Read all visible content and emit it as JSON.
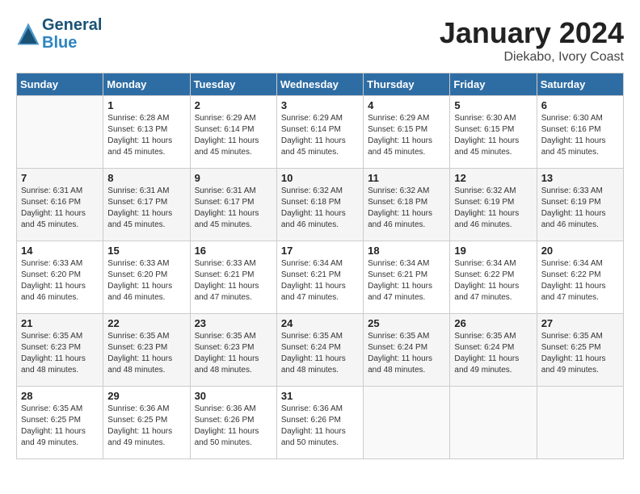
{
  "header": {
    "logo_line1": "General",
    "logo_line2": "Blue",
    "month": "January 2024",
    "location": "Diekabo, Ivory Coast"
  },
  "days_of_week": [
    "Sunday",
    "Monday",
    "Tuesday",
    "Wednesday",
    "Thursday",
    "Friday",
    "Saturday"
  ],
  "weeks": [
    [
      {
        "day": "",
        "sunrise": "",
        "sunset": "",
        "daylight": ""
      },
      {
        "day": "1",
        "sunrise": "Sunrise: 6:28 AM",
        "sunset": "Sunset: 6:13 PM",
        "daylight": "Daylight: 11 hours and 45 minutes."
      },
      {
        "day": "2",
        "sunrise": "Sunrise: 6:29 AM",
        "sunset": "Sunset: 6:14 PM",
        "daylight": "Daylight: 11 hours and 45 minutes."
      },
      {
        "day": "3",
        "sunrise": "Sunrise: 6:29 AM",
        "sunset": "Sunset: 6:14 PM",
        "daylight": "Daylight: 11 hours and 45 minutes."
      },
      {
        "day": "4",
        "sunrise": "Sunrise: 6:29 AM",
        "sunset": "Sunset: 6:15 PM",
        "daylight": "Daylight: 11 hours and 45 minutes."
      },
      {
        "day": "5",
        "sunrise": "Sunrise: 6:30 AM",
        "sunset": "Sunset: 6:15 PM",
        "daylight": "Daylight: 11 hours and 45 minutes."
      },
      {
        "day": "6",
        "sunrise": "Sunrise: 6:30 AM",
        "sunset": "Sunset: 6:16 PM",
        "daylight": "Daylight: 11 hours and 45 minutes."
      }
    ],
    [
      {
        "day": "7",
        "sunrise": "Sunrise: 6:31 AM",
        "sunset": "Sunset: 6:16 PM",
        "daylight": "Daylight: 11 hours and 45 minutes."
      },
      {
        "day": "8",
        "sunrise": "Sunrise: 6:31 AM",
        "sunset": "Sunset: 6:17 PM",
        "daylight": "Daylight: 11 hours and 45 minutes."
      },
      {
        "day": "9",
        "sunrise": "Sunrise: 6:31 AM",
        "sunset": "Sunset: 6:17 PM",
        "daylight": "Daylight: 11 hours and 45 minutes."
      },
      {
        "day": "10",
        "sunrise": "Sunrise: 6:32 AM",
        "sunset": "Sunset: 6:18 PM",
        "daylight": "Daylight: 11 hours and 46 minutes."
      },
      {
        "day": "11",
        "sunrise": "Sunrise: 6:32 AM",
        "sunset": "Sunset: 6:18 PM",
        "daylight": "Daylight: 11 hours and 46 minutes."
      },
      {
        "day": "12",
        "sunrise": "Sunrise: 6:32 AM",
        "sunset": "Sunset: 6:19 PM",
        "daylight": "Daylight: 11 hours and 46 minutes."
      },
      {
        "day": "13",
        "sunrise": "Sunrise: 6:33 AM",
        "sunset": "Sunset: 6:19 PM",
        "daylight": "Daylight: 11 hours and 46 minutes."
      }
    ],
    [
      {
        "day": "14",
        "sunrise": "Sunrise: 6:33 AM",
        "sunset": "Sunset: 6:20 PM",
        "daylight": "Daylight: 11 hours and 46 minutes."
      },
      {
        "day": "15",
        "sunrise": "Sunrise: 6:33 AM",
        "sunset": "Sunset: 6:20 PM",
        "daylight": "Daylight: 11 hours and 46 minutes."
      },
      {
        "day": "16",
        "sunrise": "Sunrise: 6:33 AM",
        "sunset": "Sunset: 6:21 PM",
        "daylight": "Daylight: 11 hours and 47 minutes."
      },
      {
        "day": "17",
        "sunrise": "Sunrise: 6:34 AM",
        "sunset": "Sunset: 6:21 PM",
        "daylight": "Daylight: 11 hours and 47 minutes."
      },
      {
        "day": "18",
        "sunrise": "Sunrise: 6:34 AM",
        "sunset": "Sunset: 6:21 PM",
        "daylight": "Daylight: 11 hours and 47 minutes."
      },
      {
        "day": "19",
        "sunrise": "Sunrise: 6:34 AM",
        "sunset": "Sunset: 6:22 PM",
        "daylight": "Daylight: 11 hours and 47 minutes."
      },
      {
        "day": "20",
        "sunrise": "Sunrise: 6:34 AM",
        "sunset": "Sunset: 6:22 PM",
        "daylight": "Daylight: 11 hours and 47 minutes."
      }
    ],
    [
      {
        "day": "21",
        "sunrise": "Sunrise: 6:35 AM",
        "sunset": "Sunset: 6:23 PM",
        "daylight": "Daylight: 11 hours and 48 minutes."
      },
      {
        "day": "22",
        "sunrise": "Sunrise: 6:35 AM",
        "sunset": "Sunset: 6:23 PM",
        "daylight": "Daylight: 11 hours and 48 minutes."
      },
      {
        "day": "23",
        "sunrise": "Sunrise: 6:35 AM",
        "sunset": "Sunset: 6:23 PM",
        "daylight": "Daylight: 11 hours and 48 minutes."
      },
      {
        "day": "24",
        "sunrise": "Sunrise: 6:35 AM",
        "sunset": "Sunset: 6:24 PM",
        "daylight": "Daylight: 11 hours and 48 minutes."
      },
      {
        "day": "25",
        "sunrise": "Sunrise: 6:35 AM",
        "sunset": "Sunset: 6:24 PM",
        "daylight": "Daylight: 11 hours and 48 minutes."
      },
      {
        "day": "26",
        "sunrise": "Sunrise: 6:35 AM",
        "sunset": "Sunset: 6:24 PM",
        "daylight": "Daylight: 11 hours and 49 minutes."
      },
      {
        "day": "27",
        "sunrise": "Sunrise: 6:35 AM",
        "sunset": "Sunset: 6:25 PM",
        "daylight": "Daylight: 11 hours and 49 minutes."
      }
    ],
    [
      {
        "day": "28",
        "sunrise": "Sunrise: 6:35 AM",
        "sunset": "Sunset: 6:25 PM",
        "daylight": "Daylight: 11 hours and 49 minutes."
      },
      {
        "day": "29",
        "sunrise": "Sunrise: 6:36 AM",
        "sunset": "Sunset: 6:25 PM",
        "daylight": "Daylight: 11 hours and 49 minutes."
      },
      {
        "day": "30",
        "sunrise": "Sunrise: 6:36 AM",
        "sunset": "Sunset: 6:26 PM",
        "daylight": "Daylight: 11 hours and 50 minutes."
      },
      {
        "day": "31",
        "sunrise": "Sunrise: 6:36 AM",
        "sunset": "Sunset: 6:26 PM",
        "daylight": "Daylight: 11 hours and 50 minutes."
      },
      {
        "day": "",
        "sunrise": "",
        "sunset": "",
        "daylight": ""
      },
      {
        "day": "",
        "sunrise": "",
        "sunset": "",
        "daylight": ""
      },
      {
        "day": "",
        "sunrise": "",
        "sunset": "",
        "daylight": ""
      }
    ]
  ]
}
